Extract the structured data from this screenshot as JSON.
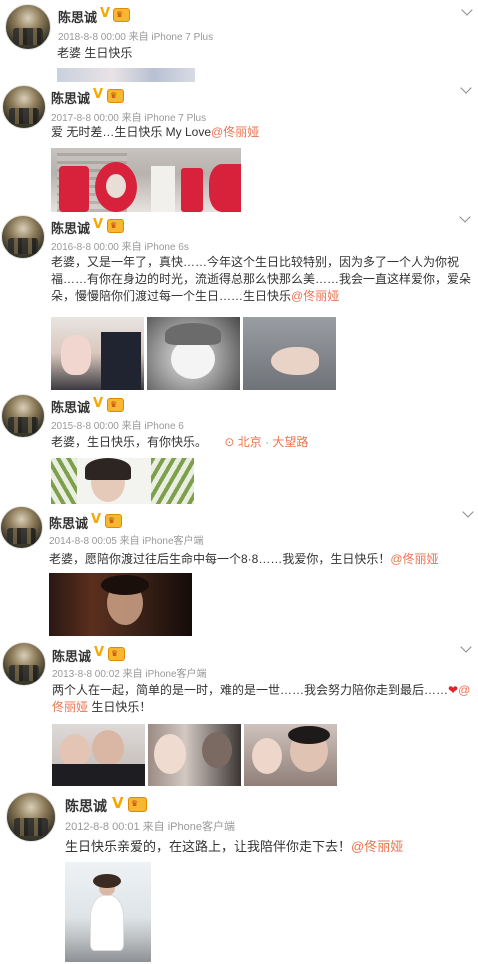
{
  "posts": [
    {
      "name": "陈思诚",
      "meta": "2018-8-8 00:00 来自 iPhone 7 Plus",
      "text": "老婆 生日快乐"
    },
    {
      "name": "陈思诚",
      "meta": "2017-8-8 00:00 来自 iPhone 7 Plus",
      "text": "爱 无时差…生日快乐 My Love",
      "mention": "@佟丽娅"
    },
    {
      "name": "陈思诚",
      "meta": "2016-8-8 00:00 来自 iPhone 6s",
      "text_line1": "老婆，又是一年了，真快……今年这个生日比较特别，因为多了一个人为你祝",
      "text_line2": "福……有你在身边的时光，流逝得总那么快那么美……我会一直这样爱你，爱朵",
      "text_line3": "朵，慢慢陪你们渡过每一个生日……生日快乐",
      "mention": "@佟丽娅"
    },
    {
      "name": "陈思诚",
      "meta": "2015-8-8 00:00 来自 iPhone 6",
      "text": "老婆，生日快乐，有你快乐。",
      "location": "北京 · 大望路"
    },
    {
      "name": "陈思诚",
      "meta": "2014-8-8 00:05 来自 iPhone客户端",
      "text": "老婆，愿陪你渡过往后生命中每一个8·8……我爱你，生日快乐！",
      "mention": "@佟丽娅"
    },
    {
      "name": "陈思诚",
      "meta": "2013-8-8 00:02 来自 iPhone客户端",
      "text_line1": "两个人在一起，简单的是一时，难的是一世……我会努力陪你走到最后……",
      "mention_at": "@",
      "mention_line2": "佟丽娅",
      "text_line2": " 生日快乐！"
    },
    {
      "name": "陈思诚",
      "meta": "2012-8-8 00:01 来自 iPhone客户端",
      "text": "生日快乐亲爱的，在这路上，让我陪伴你走下去！",
      "mention": "@佟丽娅"
    }
  ],
  "badges": {
    "verified": "V",
    "vip": "♛"
  },
  "icons": {
    "location": "location-pin-icon",
    "heart": "heart-icon",
    "more": "chevron-down-icon"
  },
  "colors": {
    "name": "#333333",
    "meta": "#999999",
    "mention": "#eb7350",
    "verified": "#f6a800"
  }
}
